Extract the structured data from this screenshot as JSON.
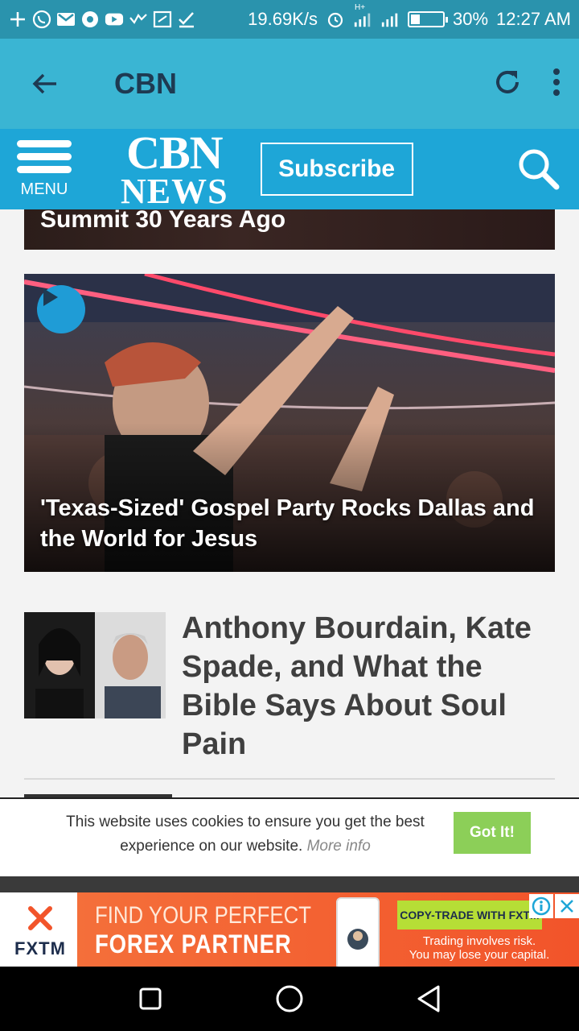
{
  "status_bar": {
    "net_speed": "19.69K/s",
    "battery": "30%",
    "battery_level": 0.3,
    "time": "12:27 AM",
    "network_type": "H+"
  },
  "app_bar": {
    "title": "CBN"
  },
  "site_header": {
    "menu_label": "MENU",
    "logo_line1": "CBN",
    "logo_line2": "NEWS",
    "subscribe_label": "Subscribe"
  },
  "articles": [
    {
      "title": "Summit 30 Years Ago"
    },
    {
      "title": "'Texas-Sized' Gospel Party Rocks Dallas and the World for Jesus",
      "has_video": true
    },
    {
      "title": "Anthony Bourdain, Kate Spade, and What the Bible Says About Soul Pain"
    }
  ],
  "cookie_banner": {
    "text": "This website uses cookies to ensure you get the best experience on our website.",
    "more_info": "More info",
    "button": "Got It!"
  },
  "ad": {
    "brand": "FXTM",
    "headline1": "FIND YOUR PERFECT",
    "headline2": "FOREX PARTNER",
    "cta": "COPY-TRADE WITH FXTM",
    "risk_line1": "Trading involves risk.",
    "risk_line2": "You may lose your capital."
  },
  "colors": {
    "status_bar": "#2a93ad",
    "app_bar": "#3ab5d3",
    "site_header": "#1ea6d7",
    "got_it": "#8ccf58",
    "ad_orange": "#f2542a"
  }
}
